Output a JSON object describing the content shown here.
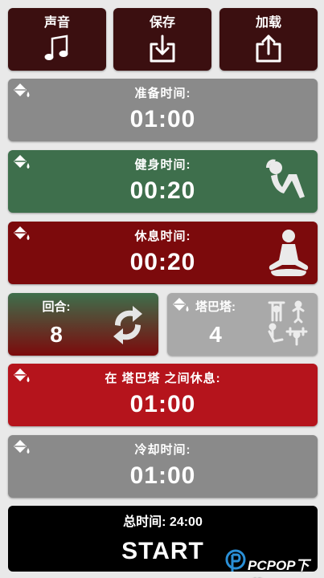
{
  "top_buttons": {
    "sound": "声音",
    "save": "保存",
    "load": "加载"
  },
  "cards": {
    "prepare": {
      "title": "准备时间:",
      "value": "01:00",
      "color": "#8a8a8a"
    },
    "work": {
      "title": "健身时间:",
      "value": "00:20",
      "color": "#3e6f4c"
    },
    "rest": {
      "title": "休息时间:",
      "value": "00:20",
      "color": "#7c0a0c"
    },
    "rounds": {
      "title": "回合:",
      "value": "8"
    },
    "tabata": {
      "title": "塔巴塔:",
      "value": "4",
      "color": "#a9a9a9"
    },
    "between": {
      "title": "在 塔巴塔 之间休息:",
      "value": "01:00",
      "color": "#b5141c"
    },
    "cooldown": {
      "title": "冷却时间:",
      "value": "01:00",
      "color": "#8a8a8a"
    }
  },
  "start": {
    "total": "总时间: 24:00",
    "label": "START"
  },
  "watermark": "PCPOP下载",
  "icons": [
    "music-note-icon",
    "save-icon",
    "upload-icon",
    "paint-bucket-icon",
    "situp-figure-icon",
    "meditation-figure-icon",
    "refresh-icon",
    "exercise-figures-icon"
  ]
}
